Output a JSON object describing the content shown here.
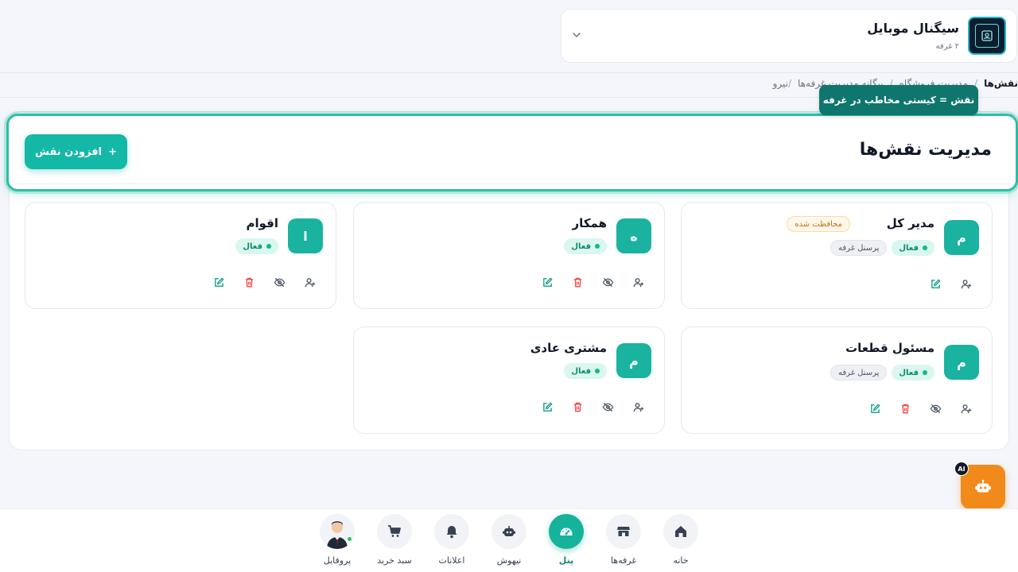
{
  "store": {
    "name": "سیگنال موبایل",
    "subtitle": "۲ غرفه"
  },
  "breadcrumb": {
    "first": "نیرو",
    "sep": "/",
    "hidden": "بیگانه مدیریت غرفه‌ها",
    "middle": "مدیریت فروشگاه",
    "current": "نقش‌ها"
  },
  "tooltip": "نقش = کیستی مخاطب در غرفه",
  "header": {
    "title": "مدیریت نقش‌ها",
    "add_button": "افزودن نقش",
    "add_icon": "+"
  },
  "roles": [
    {
      "name": "مدیر کل",
      "initial": "م",
      "protected": "محافظت شده",
      "status": "فعال",
      "staff": "پرسنل غرفه"
    },
    {
      "name": "همکار",
      "initial": "ه",
      "status": "فعال"
    },
    {
      "name": "اقوام",
      "initial": "ا",
      "status": "فعال"
    },
    {
      "name": "مسئول قطعات",
      "initial": "م",
      "status": "فعال",
      "staff": "پرسنل غرفه"
    },
    {
      "name": "مشتری عادی",
      "initial": "م",
      "status": "فعال"
    }
  ],
  "ai": {
    "tag": "AI"
  },
  "nav": {
    "home": "خانه",
    "booths": "غرفه‌ها",
    "panel": "پنل",
    "ai": "نیهوش",
    "notifications": "اعلانات",
    "cart": "سبد خرید",
    "profile": "پروفایل"
  },
  "colors": {
    "accent": "#14b8a6",
    "tooltip": "#0f766e",
    "danger": "#ef4444",
    "warning": "#f28a1b"
  }
}
